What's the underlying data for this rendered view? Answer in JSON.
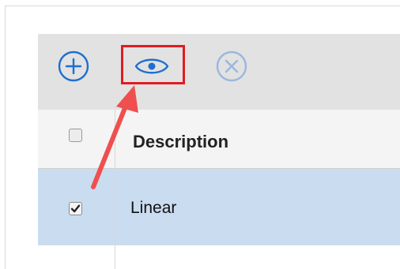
{
  "toolbar": {
    "add_icon": "plus-circle-icon",
    "view_icon": "eye-icon",
    "remove_icon": "x-circle-icon",
    "accent_color": "#1e6fcf",
    "disabled_color": "#9bb7de",
    "highlight_color": "#e01c22"
  },
  "table": {
    "columns": [
      "Description"
    ],
    "rows": [
      {
        "description": "Linear",
        "checked": true
      }
    ],
    "selected_row_color": "#cadcf0"
  },
  "annotation": {
    "arrow_color": "#ef4f4f",
    "target": "eye-icon"
  }
}
